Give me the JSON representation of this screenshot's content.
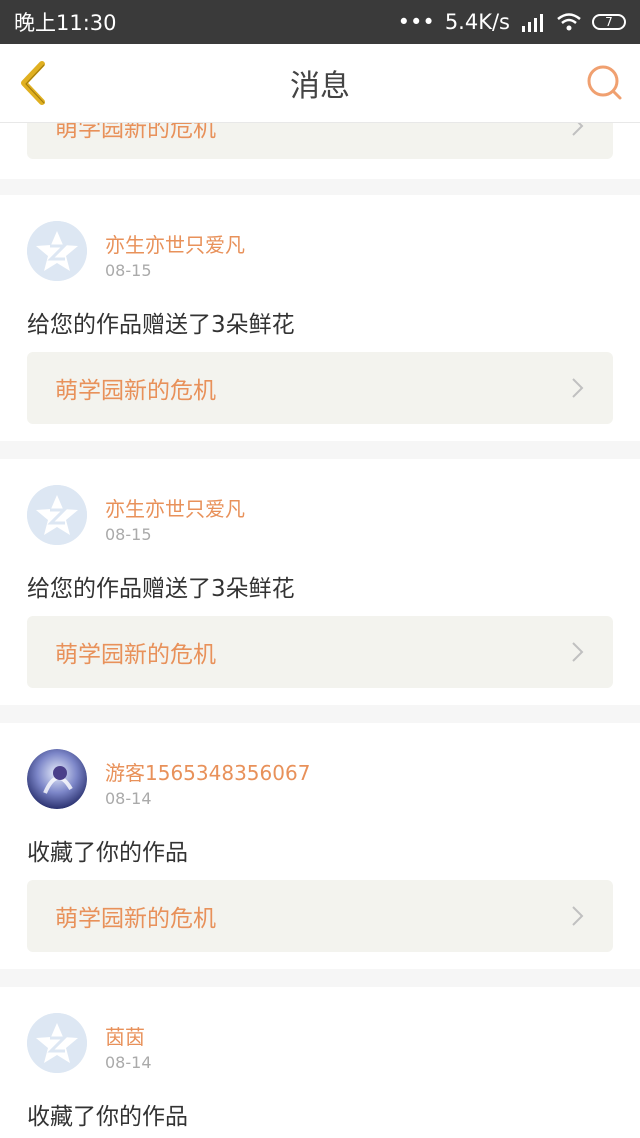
{
  "status_bar": {
    "time": "晚上11:30",
    "dots": "•••",
    "speed": "5.4K/s",
    "battery": "7"
  },
  "header": {
    "title": "消息"
  },
  "partial_card": {
    "work_title": "萌学园新的危机"
  },
  "messages": [
    {
      "user": "亦生亦世只爱凡",
      "date": "08-15",
      "text": "给您的作品赠送了3朵鲜花",
      "work_title": "萌学园新的危机",
      "avatar": "default-avatar"
    },
    {
      "user": "亦生亦世只爱凡",
      "date": "08-15",
      "text": "给您的作品赠送了3朵鲜花",
      "work_title": "萌学园新的危机",
      "avatar": "default-avatar"
    },
    {
      "user": "游客1565348356067",
      "date": "08-14",
      "text": "收藏了你的作品",
      "work_title": "萌学园新的危机",
      "avatar": "photo-avatar"
    },
    {
      "user": "茵茵",
      "date": "08-14",
      "text": "收藏了你的作品",
      "work_title": "",
      "avatar": "default-avatar"
    }
  ],
  "colors": {
    "accent": "#e8915a",
    "back_arrow": "#e0b020",
    "link_bg": "#f3f3ee"
  }
}
